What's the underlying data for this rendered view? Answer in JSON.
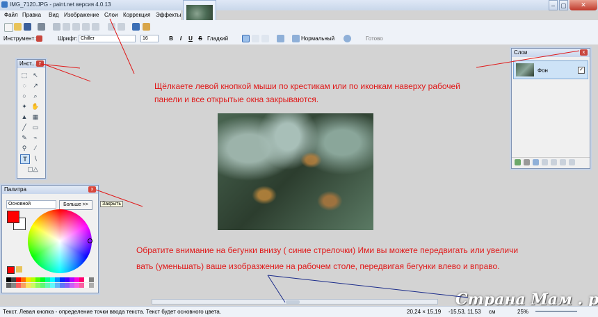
{
  "window": {
    "title": "IMG_7120.JPG - paint.net версия 4.0.13",
    "min_label": "–",
    "max_label": "▢",
    "close_label": "✕"
  },
  "menu": {
    "items": [
      "Файл",
      "Правка",
      "Вид",
      "Изображение",
      "Слои",
      "Коррекция",
      "Эффекты"
    ]
  },
  "toolbar2": {
    "tool_label": "Инструмент:",
    "font_label": "Шрифт:",
    "font_value": "Chiller",
    "size_value": "16",
    "bold": "B",
    "italic": "I",
    "underline": "U",
    "strike": "S",
    "smoothing_value": "Гладкий",
    "blend_value": "Нормальный",
    "finish_label": "Готово"
  },
  "tools_panel": {
    "title": "Инст...",
    "close_label": "x"
  },
  "palette_panel": {
    "title": "Палитра",
    "close_label": "x",
    "mode_value": "Основной",
    "more_button": "Больше >>",
    "close_tooltip": "Закрыть"
  },
  "layers_panel": {
    "title": "Слои",
    "close_label": "x",
    "layer_name": "Фон",
    "layer_visible": "✓"
  },
  "annotations": {
    "line1": "Щёлкаете левой кнопкой мыши по крестикам или по иконкам наверху рабочей",
    "line2": "панели и все открытые окна закрываются.",
    "line3": "Обратите внимание на бегунки внизу ( синие стрелочки) Ими вы можете передвигать или увеличи",
    "line4": "вать (уменьшать) ваше изобразжение на рабочем столе, передвигая бегунки влево и вправо."
  },
  "statusbar": {
    "hint": "Текст. Левая кнопка - определение точки ввода текста. Текст будет основного цвета.",
    "size": "20,24 × 15,19",
    "position": "-15,53, 11,53",
    "units": "см",
    "zoom": "25%"
  },
  "watermark": "Страна Мам . ру",
  "colors": {
    "annotation": "#e01a1a",
    "arrow_red": "#e01a1a",
    "arrow_blue": "#1a2b8a",
    "primary_color": "#ff0000"
  }
}
